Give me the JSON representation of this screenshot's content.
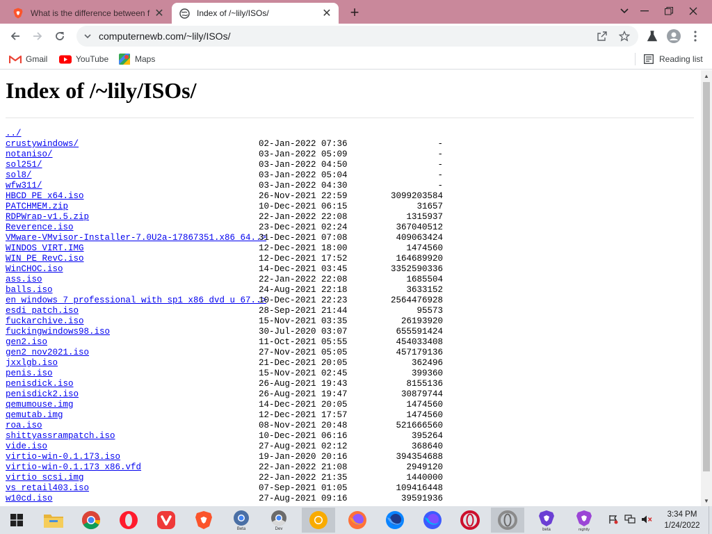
{
  "browser": {
    "tabs": [
      {
        "title": "What is the difference between f",
        "active": false,
        "icon": "brave-lion-icon"
      },
      {
        "title": "Index of /~lily/ISOs/",
        "active": true,
        "icon": "globe-icon"
      }
    ],
    "address": "computernewb.com/~lily/ISOs/",
    "bookmarks": [
      {
        "label": "Gmail",
        "icon": "gmail-icon"
      },
      {
        "label": "YouTube",
        "icon": "youtube-icon"
      },
      {
        "label": "Maps",
        "icon": "maps-icon"
      }
    ],
    "reading_list_label": "Reading list",
    "colors": {
      "tabstrip": "#c9889b",
      "link": "#0000ee"
    }
  },
  "page": {
    "title": "Index of /~lily/ISOs/",
    "parent_link": "../",
    "entries": [
      {
        "name": "crustywindows/",
        "date": "02-Jan-2022 07:36",
        "size": "-"
      },
      {
        "name": "notaniso/",
        "date": "03-Jan-2022 05:09",
        "size": "-"
      },
      {
        "name": "sol251/",
        "date": "03-Jan-2022 04:50",
        "size": "-"
      },
      {
        "name": "sol8/",
        "date": "03-Jan-2022 05:04",
        "size": "-"
      },
      {
        "name": "wfw311/",
        "date": "03-Jan-2022 04:30",
        "size": "-"
      },
      {
        "name": "HBCD_PE_x64.iso",
        "date": "26-Nov-2021 22:59",
        "size": "3099203584"
      },
      {
        "name": "PATCHMEM.zip",
        "date": "10-Dec-2021 06:15",
        "size": "31657"
      },
      {
        "name": "RDPWrap-v1.5.zip",
        "date": "22-Jan-2022 22:08",
        "size": "1315937"
      },
      {
        "name": "Reverence.iso",
        "date": "23-Dec-2021 02:24",
        "size": "367040512"
      },
      {
        "name": "VMware-VMvisor-Installer-7.0U2a-17867351.x86_64..>",
        "date": "31-Dec-2021 07:08",
        "size": "409063424"
      },
      {
        "name": "WINDOS_VIRT.IMG",
        "date": "12-Dec-2021 18:00",
        "size": "1474560"
      },
      {
        "name": "WIN_PE_RevC.iso",
        "date": "12-Dec-2021 17:52",
        "size": "164689920"
      },
      {
        "name": "WinCHOC.iso",
        "date": "14-Dec-2021 03:45",
        "size": "3352590336"
      },
      {
        "name": "ass.iso",
        "date": "22-Jan-2022 22:08",
        "size": "1685504"
      },
      {
        "name": "balls.iso",
        "date": "24-Aug-2021 22:18",
        "size": "3633152"
      },
      {
        "name": "en_windows_7_professional_with_sp1_x86_dvd_u_67..>",
        "date": "10-Dec-2021 22:23",
        "size": "2564476928"
      },
      {
        "name": "esdi_patch.iso",
        "date": "28-Sep-2021 21:44",
        "size": "95573"
      },
      {
        "name": "fuckarchive.iso",
        "date": "15-Nov-2021 03:35",
        "size": "26193920"
      },
      {
        "name": "fuckingwindows98.iso",
        "date": "30-Jul-2020 03:07",
        "size": "655591424"
      },
      {
        "name": "gen2.iso",
        "date": "11-Oct-2021 05:55",
        "size": "454033408"
      },
      {
        "name": "gen2_nov2021.iso",
        "date": "27-Nov-2021 05:05",
        "size": "457179136"
      },
      {
        "name": "jxxlgb.iso",
        "date": "21-Dec-2021 20:05",
        "size": "362496"
      },
      {
        "name": "penis.iso",
        "date": "15-Nov-2021 02:45",
        "size": "399360"
      },
      {
        "name": "penisdick.iso",
        "date": "26-Aug-2021 19:43",
        "size": "8155136"
      },
      {
        "name": "penisdick2.iso",
        "date": "26-Aug-2021 19:47",
        "size": "30879744"
      },
      {
        "name": "qemumouse.img",
        "date": "14-Dec-2021 20:05",
        "size": "1474560"
      },
      {
        "name": "qemutab.img",
        "date": "12-Dec-2021 17:57",
        "size": "1474560"
      },
      {
        "name": "roa.iso",
        "date": "08-Nov-2021 20:48",
        "size": "521666560"
      },
      {
        "name": "shittyassrampatch.iso",
        "date": "10-Dec-2021 06:16",
        "size": "395264"
      },
      {
        "name": "vide.iso",
        "date": "27-Aug-2021 02:12",
        "size": "368640"
      },
      {
        "name": "virtio-win-0.1.173.iso",
        "date": "19-Jan-2020 20:16",
        "size": "394354688"
      },
      {
        "name": "virtio-win-0.1.173_x86.vfd",
        "date": "22-Jan-2022 21:08",
        "size": "2949120"
      },
      {
        "name": "virtio_scsi.img",
        "date": "22-Jan-2022 21:35",
        "size": "1440000"
      },
      {
        "name": "vs_retail403.iso",
        "date": "07-Sep-2021 01:05",
        "size": "109416448"
      },
      {
        "name": "w10cd.iso",
        "date": "27-Aug-2021 09:16",
        "size": "39591936"
      }
    ]
  },
  "taskbar": {
    "apps": [
      {
        "name": "file-explorer-icon"
      },
      {
        "name": "chrome-icon"
      },
      {
        "name": "opera-icon"
      },
      {
        "name": "vivaldi-icon"
      },
      {
        "name": "brave-icon"
      },
      {
        "name": "chrome-beta-icon",
        "badge": "Beta"
      },
      {
        "name": "chrome-dev-icon",
        "badge": "Dev"
      },
      {
        "name": "chrome-canary-icon",
        "active": true
      },
      {
        "name": "firefox-icon"
      },
      {
        "name": "firefox-developer-icon"
      },
      {
        "name": "firefox-nightly-icon"
      },
      {
        "name": "opera-gx-icon"
      },
      {
        "name": "opera-active-icon",
        "active": true
      },
      {
        "name": "brave-beta-icon",
        "badge": "beta"
      },
      {
        "name": "brave-nightly-icon",
        "badge": "nightly"
      }
    ],
    "time": "3:34 PM",
    "date": "1/24/2022"
  }
}
